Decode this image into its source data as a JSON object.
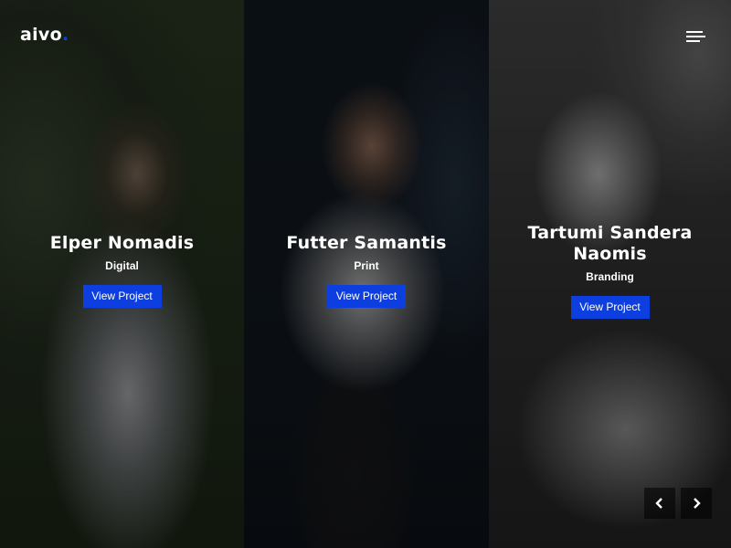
{
  "brand": {
    "logo_text": "aivo",
    "logo_dot": ".",
    "accent": "#0d3fe0"
  },
  "header": {
    "menu_icon": "hamburger-icon"
  },
  "projects": [
    {
      "title": "Elper Nomadis",
      "category": "Digital",
      "button": "View Project"
    },
    {
      "title": "Futter Samantis",
      "category": "Print",
      "button": "View Project"
    },
    {
      "title": "Tartumi Sandera Naomis",
      "category": "Branding",
      "button": "View Project"
    }
  ],
  "slider": {
    "prev_icon": "chevron-left-icon",
    "next_icon": "chevron-right-icon"
  }
}
